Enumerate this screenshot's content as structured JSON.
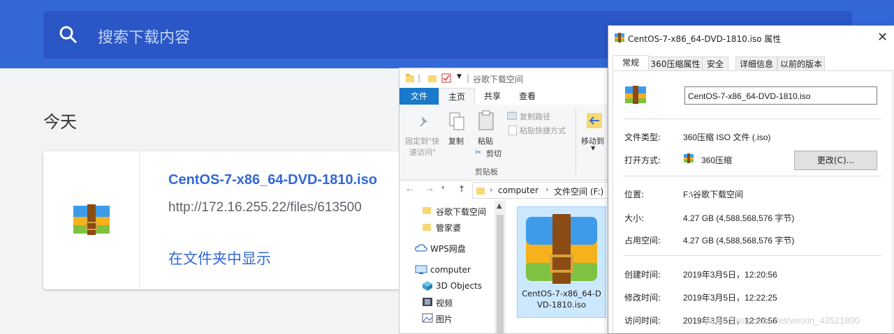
{
  "chrome": {
    "search_placeholder": "搜索下载内容",
    "section_today": "今天",
    "download": {
      "filename": "CentOS-7-x86_64-DVD-1810.iso",
      "url": "http://172.16.255.22/files/613500",
      "show_in_folder": "在文件夹中显示"
    },
    "colors": {
      "header": "#3367d6",
      "link": "#3367d6"
    }
  },
  "explorer": {
    "window_title": "谷歌下载空间",
    "tabs": [
      "文件",
      "主页",
      "共享",
      "查看"
    ],
    "ribbon": {
      "pin_label_1": "固定到\"快",
      "pin_label_2": "速访问\"",
      "copy": "复制",
      "paste": "粘贴",
      "copy_path": "复制路径",
      "paste_shortcut": "粘贴快捷方式",
      "cut": "剪切",
      "clipboard_group": "剪贴板",
      "move_to": "移动到"
    },
    "address": {
      "part1": "computer",
      "part2": "文件空间 (F:)"
    },
    "nav_items": [
      "谷歌下载空间",
      "管家婆",
      "WPS网盘",
      "computer",
      "3D Objects",
      "视频",
      "图片"
    ],
    "file_tile_name": "CentOS-7-x86_64-DVD-1810.iso",
    "file_tile_name_line1": "CentOS-7-x86_64-D",
    "file_tile_name_line2": "VD-1810.iso"
  },
  "properties": {
    "title": "CentOS-7-x86_64-DVD-1810.iso 属性",
    "tabs": [
      "常规",
      "360压缩属性",
      "安全",
      "详细信息",
      "以前的版本"
    ],
    "filename": "CentOS-7-x86_64-DVD-1810.iso",
    "rows": {
      "type_label": "文件类型:",
      "type_value": "360压缩 ISO 文件 (.iso)",
      "open_label": "打开方式:",
      "open_value": "360压缩",
      "change_btn": "更改(C)...",
      "location_label": "位置:",
      "location_value": "F:\\谷歌下载空间",
      "size_label": "大小:",
      "size_value": "4.27 GB (4,588,568,576 字节)",
      "disk_label": "占用空间:",
      "disk_value": "4.27 GB (4,588,568,576 字节)",
      "created_label": "创建时间:",
      "created_value": "2019年3月5日，12:20:56",
      "modified_label": "修改时间:",
      "modified_value": "2019年3月5日，12:22:25",
      "accessed_label": "访问时间:",
      "accessed_value": "2019年3月5日，12:20:56"
    }
  },
  "watermark": "https://blog.csdn.net/weixin_43521890"
}
